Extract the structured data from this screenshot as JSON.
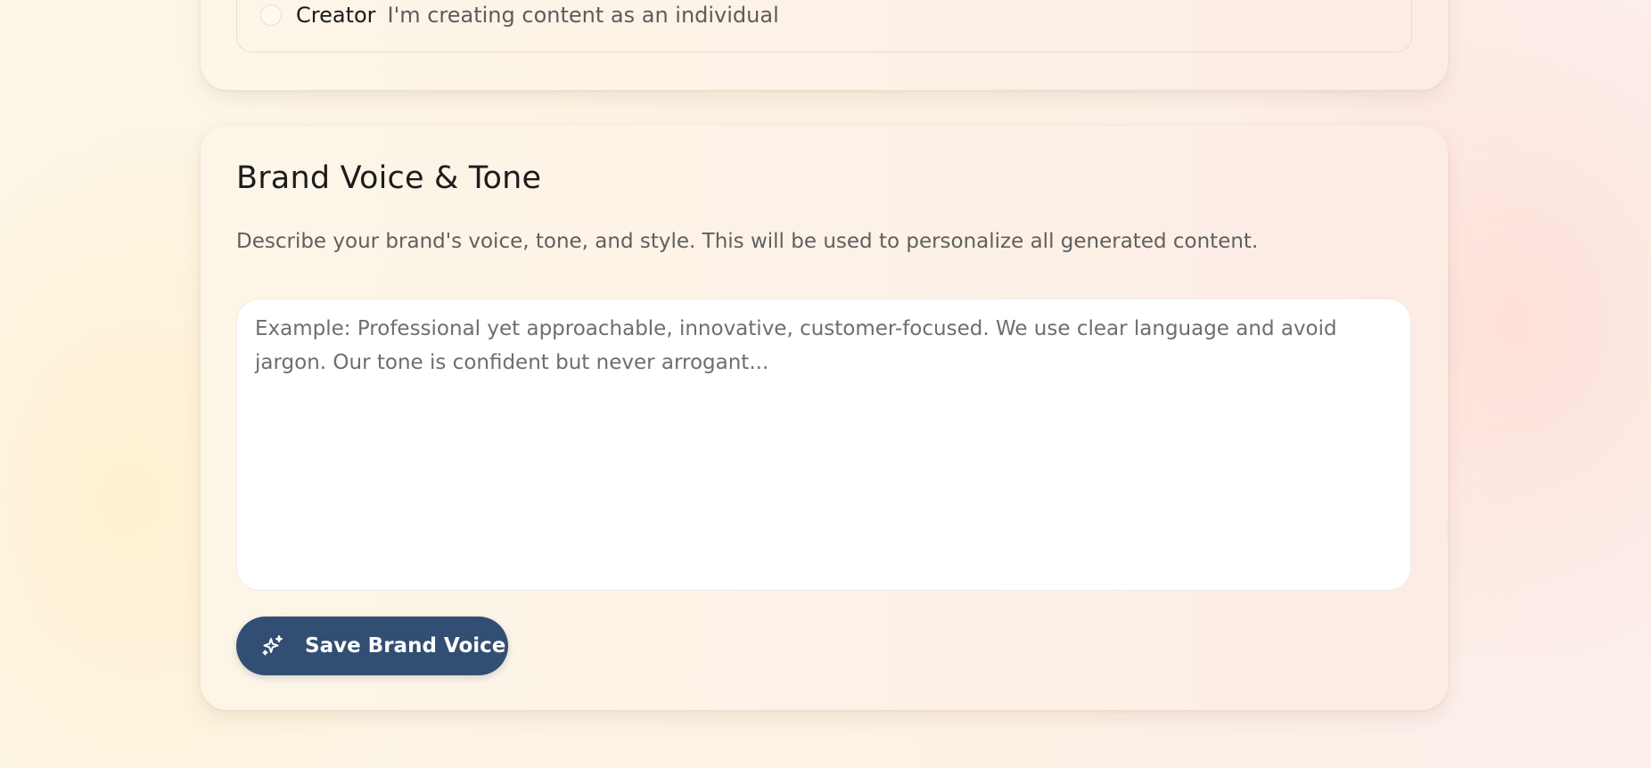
{
  "business_type": {
    "option": {
      "title": "Creator",
      "description": "I'm creating content as an individual"
    }
  },
  "brand_voice": {
    "title": "Brand Voice & Tone",
    "description": "Describe your brand's voice, tone, and style. This will be used to personalize all generated content.",
    "textarea_value": "",
    "textarea_placeholder": "Example: Professional yet approachable, innovative, customer-focused. We use clear language and avoid jargon. Our tone is confident but never arrogant...",
    "save_label": "Save Brand Voice",
    "save_icon": "sparkles-icon",
    "button_color": "#334e73"
  }
}
